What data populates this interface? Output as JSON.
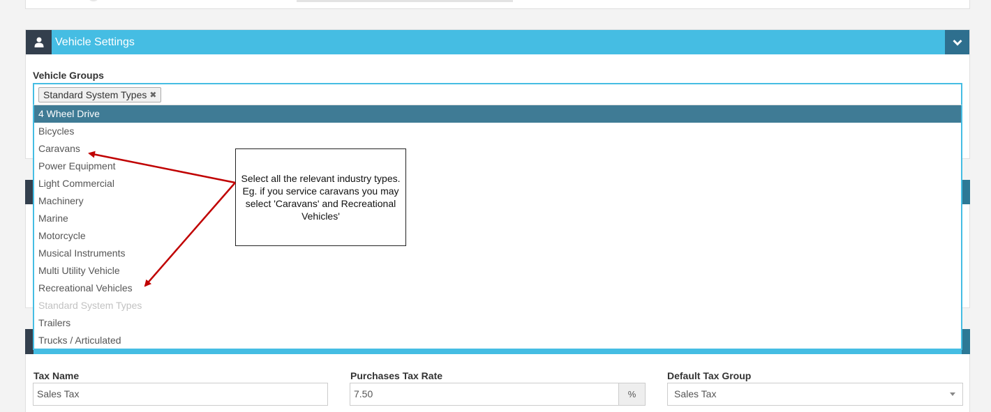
{
  "vehicle_settings": {
    "title": "Vehicle Settings",
    "header_icon": "user-icon",
    "toggle_icon": "chevron-down-icon",
    "groups_label": "Vehicle Groups",
    "selected_tag": "Standard System Types",
    "remove_glyph": "✖",
    "options": [
      "4 Wheel Drive",
      "Bicycles",
      "Caravans",
      "Power Equipment",
      "Light Commercial",
      "Machinery",
      "Marine",
      "Motorcycle",
      "Musical Instruments",
      "Multi Utility Vehicle",
      "Recreational Vehicles",
      "Standard System Types",
      "Trailers",
      "Trucks / Articulated"
    ],
    "highlighted_option": "4 Wheel Drive",
    "disabled_option": "Standard System Types"
  },
  "callout": {
    "text": "Select all the relevant industry types. Eg. if you service caravans you may select 'Caravans' and Recreational Vehicles'",
    "arrow_color": "#c00000"
  },
  "tax": {
    "name_label": "Tax Name",
    "name_value": "Sales Tax",
    "rate_label": "Purchases Tax Rate",
    "rate_value": "7.50",
    "rate_unit": "%",
    "group_label": "Default Tax Group",
    "group_value": "Sales Tax"
  },
  "colors": {
    "header": "#45bde3",
    "header_icon_bg": "#333f4d",
    "highlight": "#3f7b95"
  }
}
